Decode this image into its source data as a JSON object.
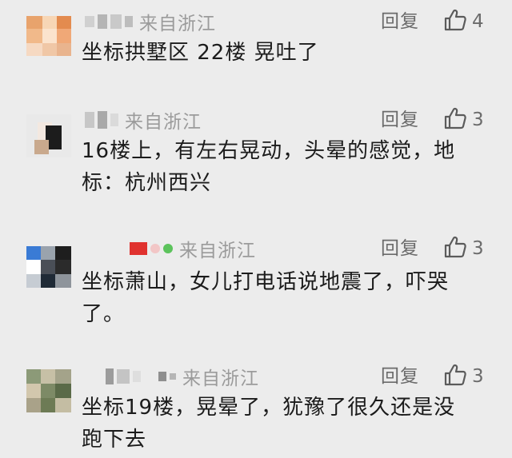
{
  "comments": [
    {
      "source": "来自浙江",
      "reply_label": "回复",
      "likes": "4",
      "text": "坐标拱墅区 22楼 晃吐了"
    },
    {
      "source": "来自浙江",
      "reply_label": "回复",
      "likes": "3",
      "text_line1": "16楼上，有左右晃动，头晕的感觉，地",
      "text_line2": "标：杭州西兴"
    },
    {
      "source": "来自浙江",
      "reply_label": "回复",
      "likes": "3",
      "text_line1": "坐标萧山，女儿打电话说地震了，吓哭",
      "text_line2": "了。"
    },
    {
      "source": "来自浙江",
      "reply_label": "回复",
      "likes": "3",
      "text_line1": "坐标19楼，晃晕了，犹豫了很久还是没",
      "text_line2": "跑下去"
    }
  ],
  "colors": {
    "background": "#ececec",
    "source_text": "#9b9b9b",
    "action_text": "#6b6b6b",
    "body_text": "#1b1b1b"
  },
  "icons": {
    "like": "thumbs-up-icon",
    "avatar": "blurred-avatar"
  }
}
